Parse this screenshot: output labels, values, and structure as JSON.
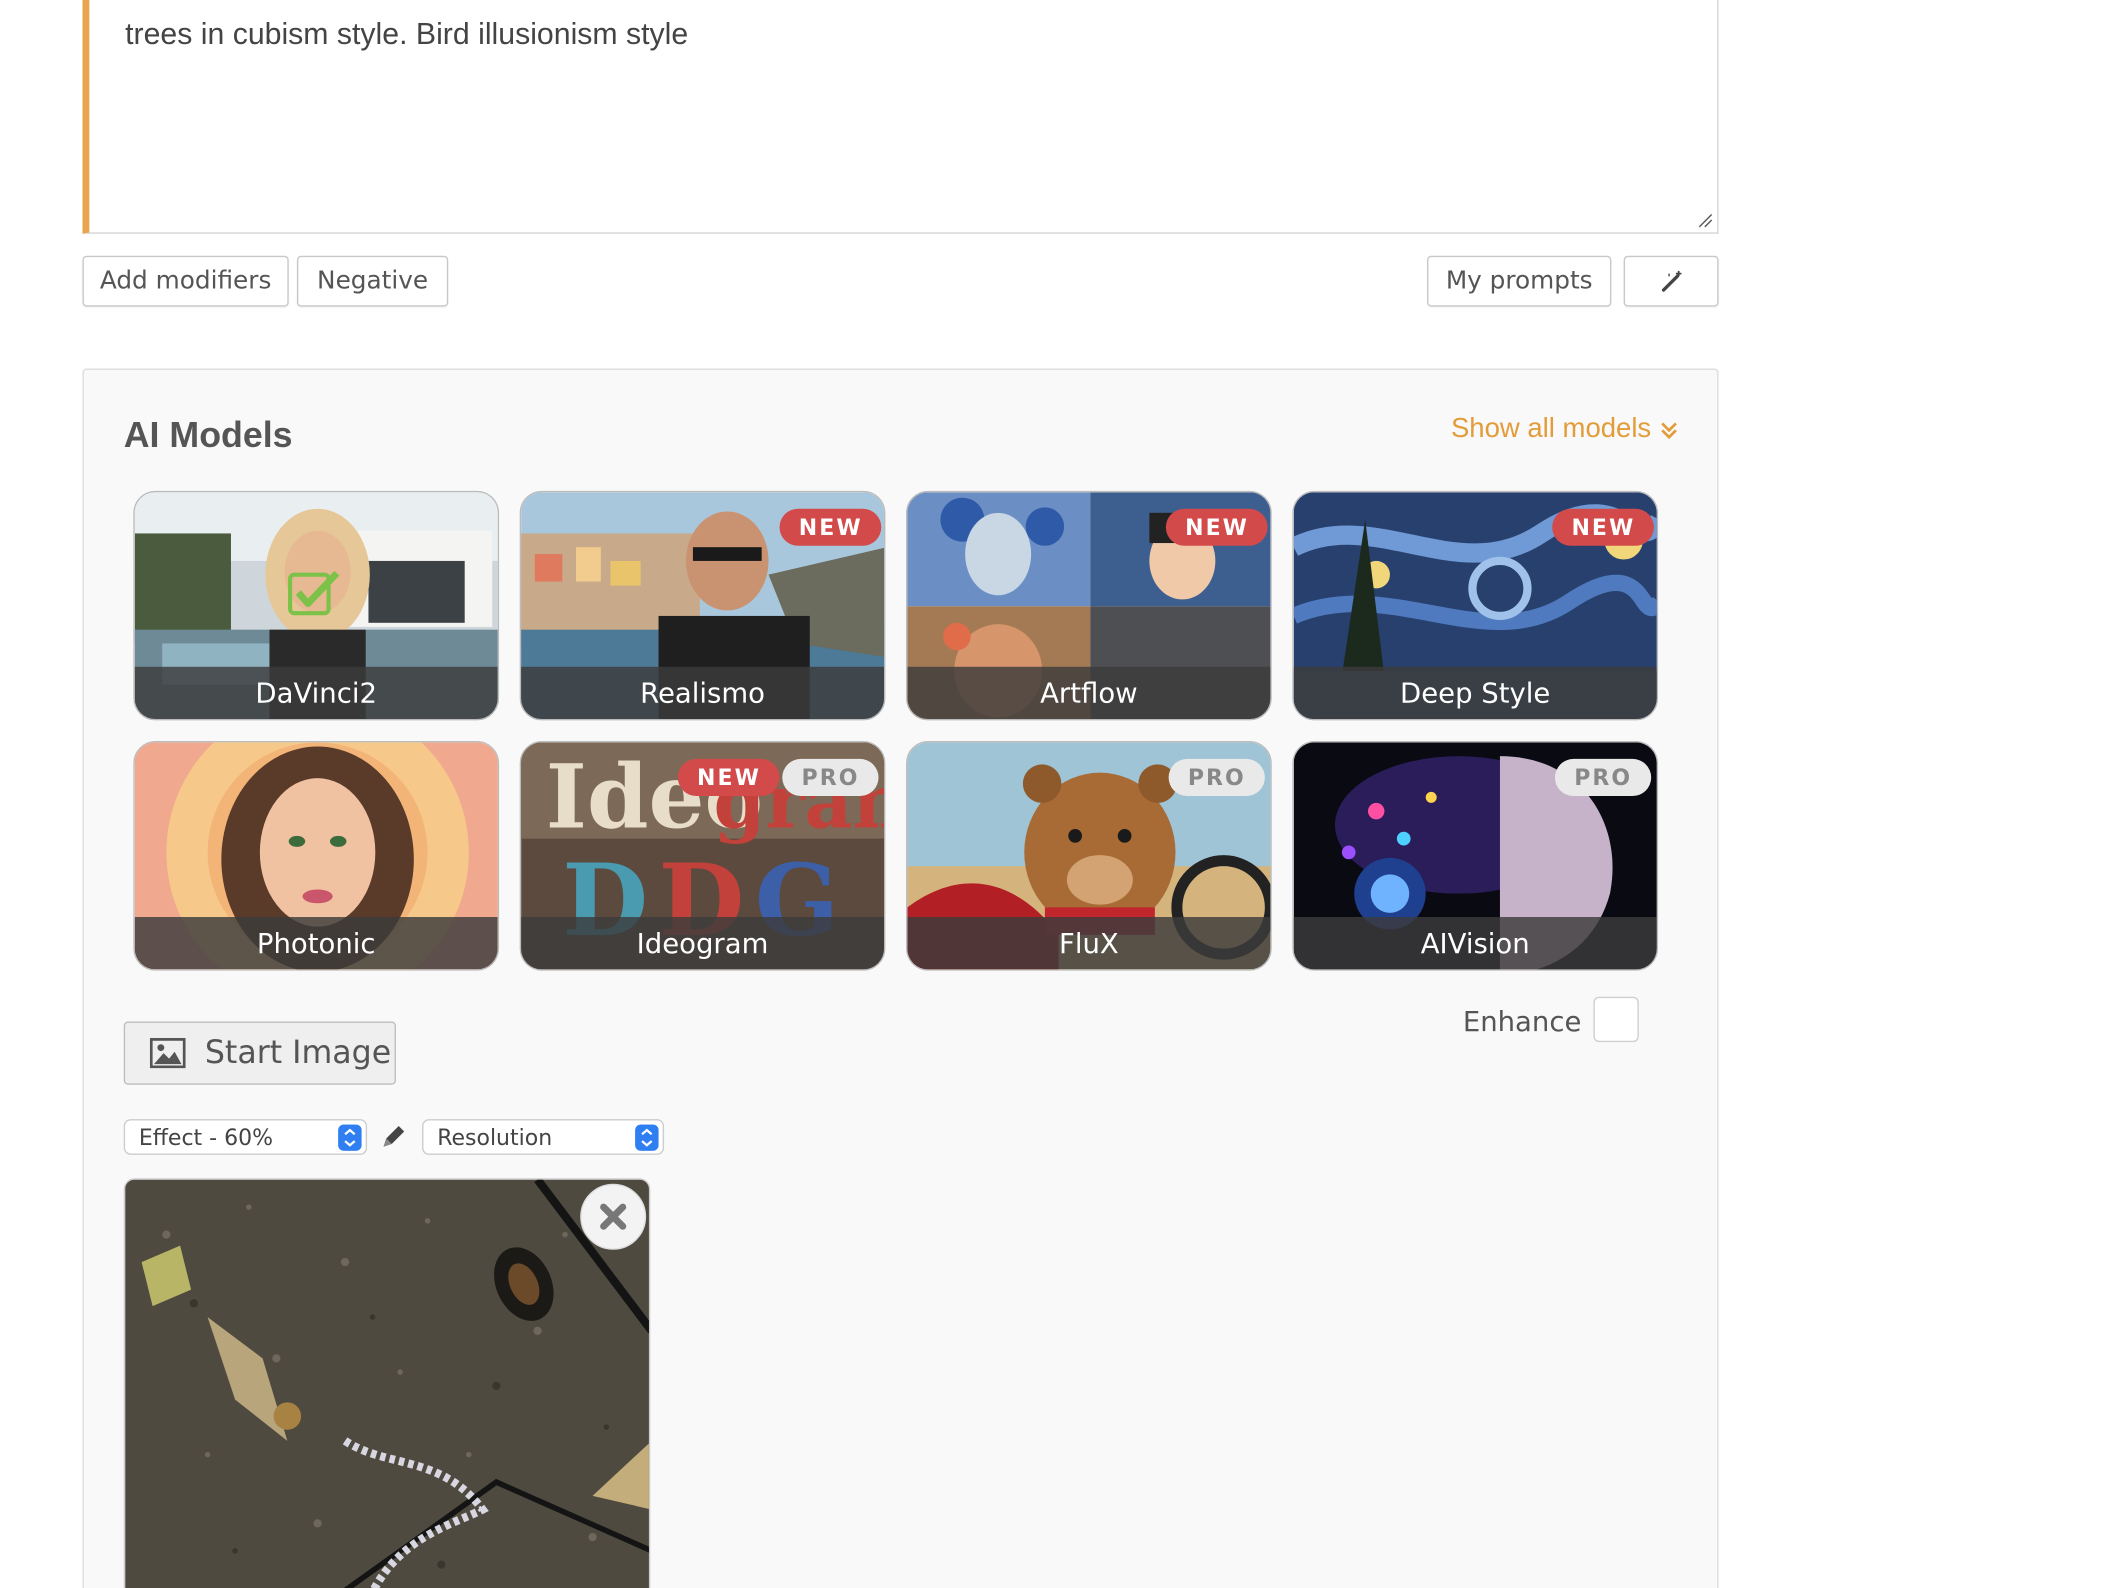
{
  "prompt": {
    "text": "trees in cubism style. Bird illusionism style"
  },
  "toolbar": {
    "add_modifiers": "Add modifiers",
    "negative": "Negative",
    "my_prompts": "My prompts",
    "magic_icon": "magic-wand-icon"
  },
  "models": {
    "title": "AI Models",
    "show_all": "Show all models",
    "items": [
      {
        "label": "DaVinci2",
        "selected": true,
        "badges": []
      },
      {
        "label": "Realismo",
        "badges": [
          "NEW"
        ]
      },
      {
        "label": "Artflow",
        "badges": [
          "NEW"
        ]
      },
      {
        "label": "Deep Style",
        "badges": [
          "NEW"
        ]
      },
      {
        "label": "Photonic",
        "badges": []
      },
      {
        "label": "Ideogram",
        "badges": [
          "NEW",
          "PRO"
        ]
      },
      {
        "label": "FluX",
        "badges": [
          "PRO"
        ]
      },
      {
        "label": "AIVision",
        "badges": [
          "PRO"
        ]
      }
    ],
    "badge_new": "NEW",
    "badge_pro": "PRO"
  },
  "start_image": {
    "label": "Start Image"
  },
  "enhance": {
    "label": "Enhance",
    "checked": false
  },
  "controls": {
    "effect": "Effect - 60%",
    "resolution": "Resolution"
  },
  "colors": {
    "accent": "#e39c3a",
    "prompt_border": "#e8a44f",
    "badge_new": "#d24a4a"
  }
}
